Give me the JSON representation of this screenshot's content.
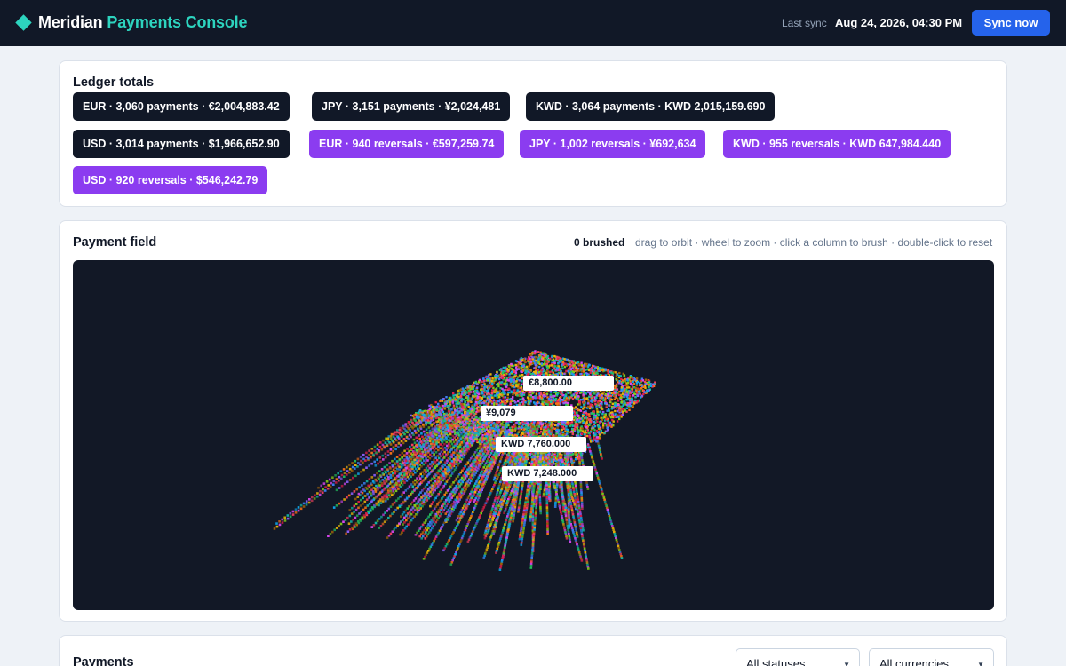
{
  "app": {
    "brand_name": "Meridian",
    "brand_sub": "Payments Console",
    "sync_label": "Last sync",
    "sync_time": "Aug 24, 2026, 04:30 PM",
    "sync_button": "Sync now"
  },
  "ledger": {
    "title": "Ledger totals",
    "pills": [
      "EUR · 3,060 payments · €2,004,883.42",
      "JPY · 3,151 payments · ¥2,024,481",
      "KWD · 3,064 payments · KWD 2,015,159.690",
      "USD · 3,014 payments · $1,966,652.90",
      "EUR · 940 reversals · €597,259.74",
      "JPY · 1,002 reversals · ¥692,634",
      "KWD · 955 reversals · KWD 647,984.440",
      "USD · 920 reversals · $546,242.79"
    ]
  },
  "field": {
    "title": "Payment field",
    "brushed": "0 brushed",
    "hint": "drag to orbit · wheel to zoom · click a column to brush · double-click to reset",
    "labels": [
      "€8,800.00",
      "¥9,079",
      "KWD 7,760.000",
      "KWD 7,248.000"
    ]
  },
  "payments": {
    "title": "Payments",
    "status_filter": "All statuses",
    "currency_filter": "All currencies"
  },
  "colors": {
    "topbar": "#111827",
    "accent": "#2dd4bf",
    "primary": "#2563eb",
    "payment_pill": "#111827",
    "reversal_pill": "#8b3cf0",
    "field_bg": "#121826"
  }
}
